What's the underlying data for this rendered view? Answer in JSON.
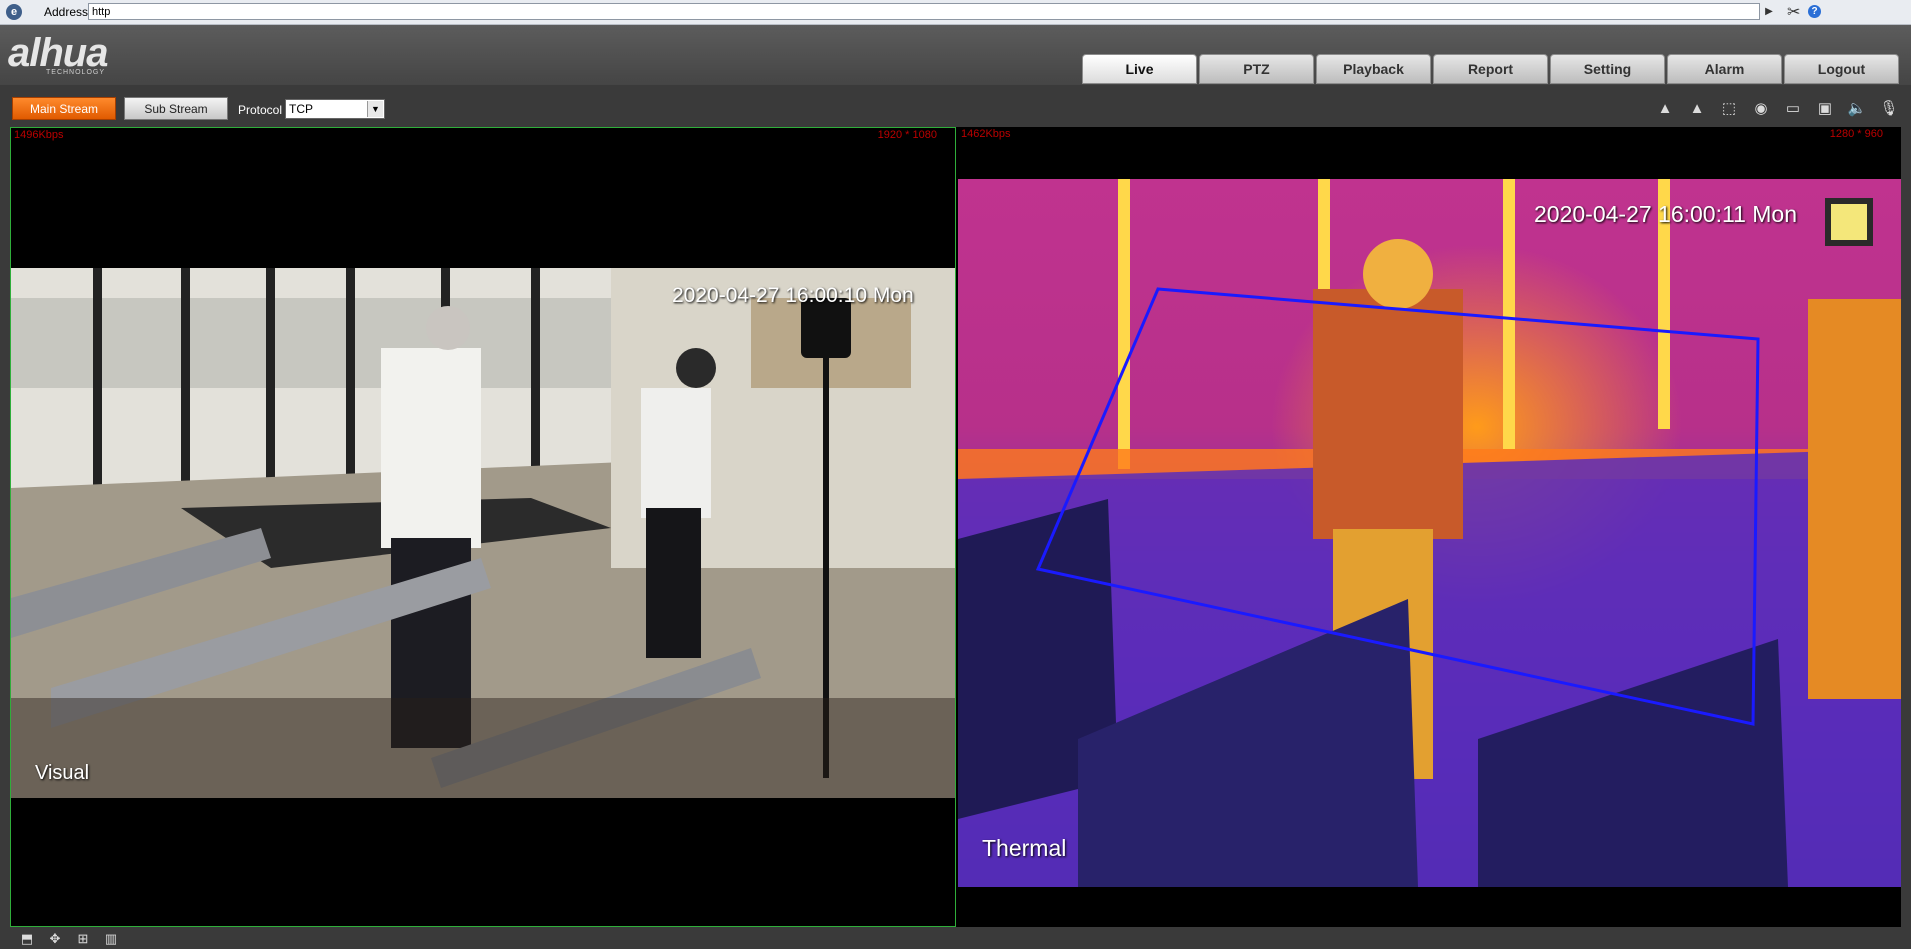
{
  "address_bar": {
    "label": "Address:",
    "value": "http"
  },
  "brand": {
    "logo": "alhua",
    "sub": "TECHNOLOGY"
  },
  "nav": {
    "tabs": [
      {
        "label": "Live",
        "active": true
      },
      {
        "label": "PTZ",
        "active": false
      },
      {
        "label": "Playback",
        "active": false
      },
      {
        "label": "Report",
        "active": false
      },
      {
        "label": "Setting",
        "active": false
      },
      {
        "label": "Alarm",
        "active": false
      },
      {
        "label": "Logout",
        "active": false
      }
    ]
  },
  "toolbar": {
    "main_stream": "Main Stream",
    "sub_stream": "Sub Stream",
    "protocol_label": "Protocol",
    "protocol_value": "TCP",
    "icons": [
      "alarm-out-1-icon",
      "alarm-out-2-icon",
      "zoom-region-icon",
      "snapshot-icon",
      "record-icon",
      "video-clip-icon",
      "volume-icon",
      "microphone-icon"
    ]
  },
  "panes": {
    "left": {
      "bitrate": "1496Kbps",
      "resolution": "1920 * 1080",
      "timestamp": "2020-04-27 16:00:10 Mon",
      "label": "Visual"
    },
    "right": {
      "bitrate": "1462Kbps",
      "resolution": "1280 * 960",
      "timestamp": "2020-04-27 16:00:11 Mon",
      "label": "Thermal"
    }
  },
  "bottom_icons": [
    "layout-1-icon",
    "layout-ptz-icon",
    "layout-grid-icon",
    "stats-icon"
  ],
  "colors": {
    "accent": "#f07000",
    "pane_border": "#2fae3a",
    "zone": "#1a1aff"
  }
}
